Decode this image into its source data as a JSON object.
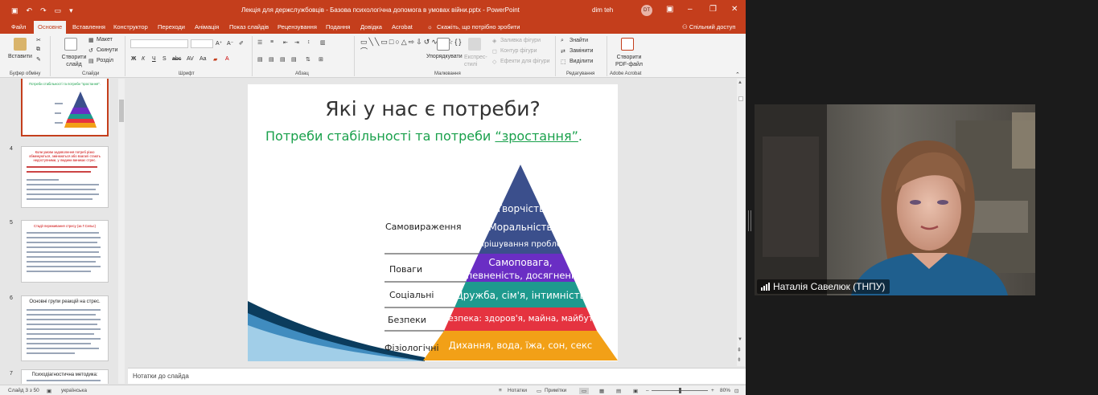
{
  "window": {
    "title": "Лекція для держслужбовців - Базова психологічна допомога в умовах війни.pptx  -  PowerPoint",
    "user": "dim teh",
    "user_initials": "DT"
  },
  "ribbon_tabs": [
    "Файл",
    "Основне",
    "Вставлення",
    "Конструктор",
    "Переходи",
    "Анімація",
    "Показ слайдів",
    "Рецензування",
    "Подання",
    "Довідка",
    "Acrobat"
  ],
  "tell_me": "Скажіть, що потрібно зробити",
  "share": "Спільний доступ",
  "ribbon": {
    "paste": "Вставити",
    "clipboard_group": "Буфер обміну",
    "new_slide": "Створити слайд",
    "layout": "Макет",
    "reset": "Скинути",
    "section": "Розділ",
    "slides_group": "Слайди",
    "font_group": "Шрифт",
    "paragraph_group": "Абзац",
    "arrange": "Упорядкувати",
    "express_styles": "Експрес-стилі",
    "fill": "Заливка фігури",
    "outline": "Контур фігури",
    "effects": "Ефекти для фігури",
    "drawing_group": "Малювання",
    "find": "Знайти",
    "replace": "Замінити",
    "select": "Виділити",
    "editing_group": "Редагування",
    "create_pdf": "Створити PDF-файл",
    "acrobat_group": "Adobe Acrobat"
  },
  "thumbnails": [
    {
      "num": "",
      "title": "Потреби стабільності та потреби \"зростання\"."
    },
    {
      "num": "4",
      "title": "Коли умови задоволення потреб різко обмежуються, змінюються або взагалі стають недоступними, у людини виникає стрес."
    },
    {
      "num": "5",
      "title": "Стадії переживання стресу (за Г.Сельє)"
    },
    {
      "num": "6",
      "title": "Основні групи реакцій на стрес."
    },
    {
      "num": "7",
      "title": "Психодіагностична методика:"
    }
  ],
  "slide": {
    "title": "Які у нас є потреби?",
    "subtitle_plain": "Потреби стабільності та потреби ",
    "subtitle_underlined": "“зростання”",
    "subtitle_end": ".",
    "levels": [
      {
        "label": "Самовираження",
        "lines": [
          "Творчість",
          "Моральність",
          "Вирішування проблем"
        ],
        "color": "#3b4f8c"
      },
      {
        "label": "Поваги",
        "lines": [
          "Самоповага,",
          "впевненість, досягнення"
        ],
        "color": "#6a2ec4"
      },
      {
        "label": "Соціальні",
        "lines": [
          "Дружба, сім'я, інтимність"
        ],
        "color": "#1e9a8e"
      },
      {
        "label": "Безпеки",
        "lines": [
          "Безпека: здоров'я, майна, майбутнього"
        ],
        "color": "#e53340"
      },
      {
        "label": "Фізіологічні",
        "lines": [
          "Дихання, вода, їжа, сон, секс"
        ],
        "color": "#f2a017"
      }
    ]
  },
  "notes_placeholder": "Нотатки до слайда",
  "status": {
    "slide_info": "Слайд 3 з 50",
    "language": "українська",
    "notes": "Нотатки",
    "comments": "Примітки",
    "zoom": "80%"
  },
  "video": {
    "participant": "Наталія Савелюк (ТНПУ)"
  }
}
